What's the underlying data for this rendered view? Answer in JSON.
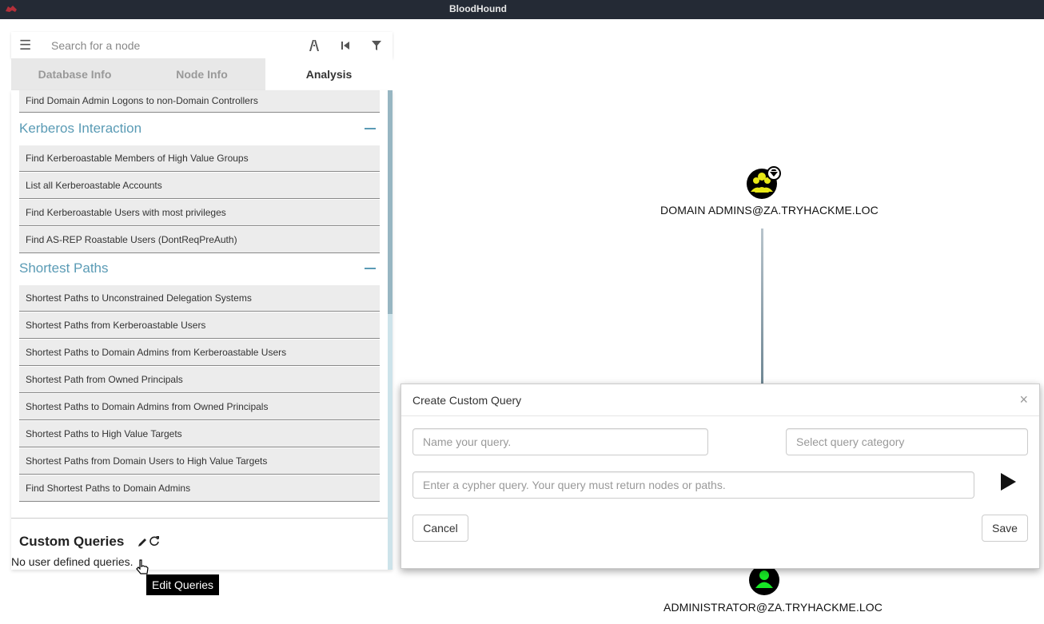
{
  "window": {
    "title": "BloodHound"
  },
  "search": {
    "placeholder": "Search for a node"
  },
  "tabs": [
    {
      "label": "Database Info"
    },
    {
      "label": "Node Info"
    },
    {
      "label": "Analysis"
    }
  ],
  "analysis": {
    "top_item": "Find Domain Admin Logons to non-Domain Controllers",
    "sections": [
      {
        "title": "Kerberos Interaction",
        "items": [
          "Find Kerberoastable Members of High Value Groups",
          "List all Kerberoastable Accounts",
          "Find Kerberoastable Users with most privileges",
          "Find AS-REP Roastable Users (DontReqPreAuth)"
        ]
      },
      {
        "title": "Shortest Paths",
        "items": [
          "Shortest Paths to Unconstrained Delegation Systems",
          "Shortest Paths from Kerberoastable Users",
          "Shortest Paths to Domain Admins from Kerberoastable Users",
          "Shortest Path from Owned Principals",
          "Shortest Paths to Domain Admins from Owned Principals",
          "Shortest Paths to High Value Targets",
          "Shortest Paths from Domain Users to High Value Targets",
          "Find Shortest Paths to Domain Admins"
        ]
      }
    ],
    "custom_queries_title": "Custom Queries",
    "no_queries_text": "No user defined queries.",
    "tooltip": "Edit Queries"
  },
  "graph": {
    "nodes": [
      {
        "label": "DOMAIN ADMINS@ZA.TRYHACKME.LOC",
        "kind": "group",
        "color": "#e8e816",
        "highvalue": true
      },
      {
        "label": "ADMINISTRATOR@ZA.TRYHACKME.LOC",
        "kind": "user",
        "color": "#17e625"
      }
    ]
  },
  "modal": {
    "title": "Create Custom Query",
    "close": "×",
    "name_placeholder": "Name your query.",
    "category_placeholder": "Select query category",
    "query_placeholder": "Enter a cypher query. Your query must return nodes or paths.",
    "cancel_label": "Cancel",
    "save_label": "Save"
  },
  "colors": {
    "titlebar": "#242a35",
    "section_heading": "#5a9bb5",
    "query_item_bg": "#ececec"
  }
}
